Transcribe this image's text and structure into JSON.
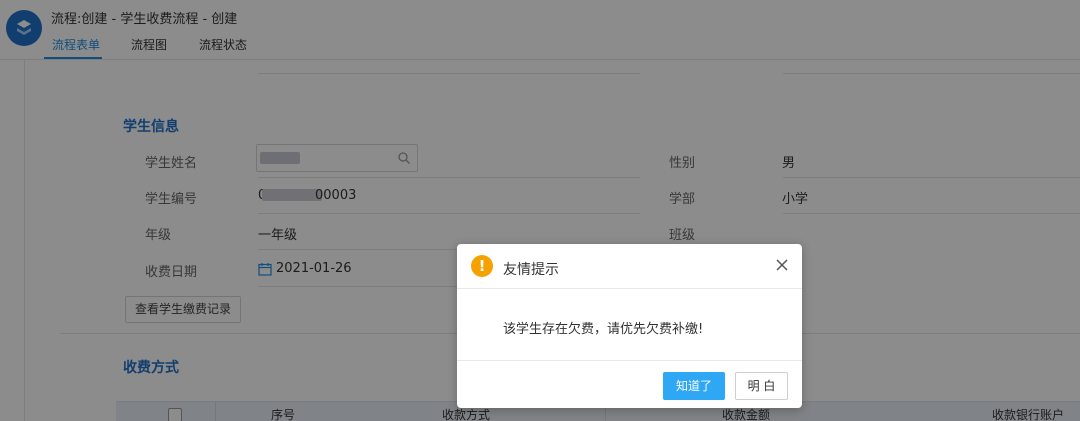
{
  "header": {
    "title": "流程:创建 - 学生收费流程 - 创建",
    "tabs": [
      {
        "label": "流程表单",
        "active": true
      },
      {
        "label": "流程图",
        "active": false
      },
      {
        "label": "流程状态",
        "active": false
      }
    ]
  },
  "student_info": {
    "section_title": "学生信息",
    "fields": {
      "name_label": "学生姓名",
      "gender_label": "性别",
      "gender_value": "男",
      "student_no_label": "学生编号",
      "student_no_value_prefix": "0",
      "student_no_value_suffix": "00003",
      "department_label": "学部",
      "department_value": "小学",
      "grade_label": "年级",
      "grade_value": "一年级",
      "class_label": "班级",
      "fee_date_label": "收费日期",
      "fee_date_value": "2021-01-26"
    },
    "view_records_button": "查看学生缴费记录"
  },
  "payment": {
    "section_title": "收费方式",
    "columns": [
      "序号",
      "收款方式",
      "收款金额",
      "收款银行账户"
    ]
  },
  "dialog": {
    "title": "友情提示",
    "message": "该学生存在欠费，请优先欠费补缴!",
    "confirm_label": "知道了",
    "secondary_label": "明 白",
    "icon": "warning-icon",
    "icon_glyph": "!",
    "accent_color": "#2ea7f5",
    "warning_color": "#f5a100"
  }
}
